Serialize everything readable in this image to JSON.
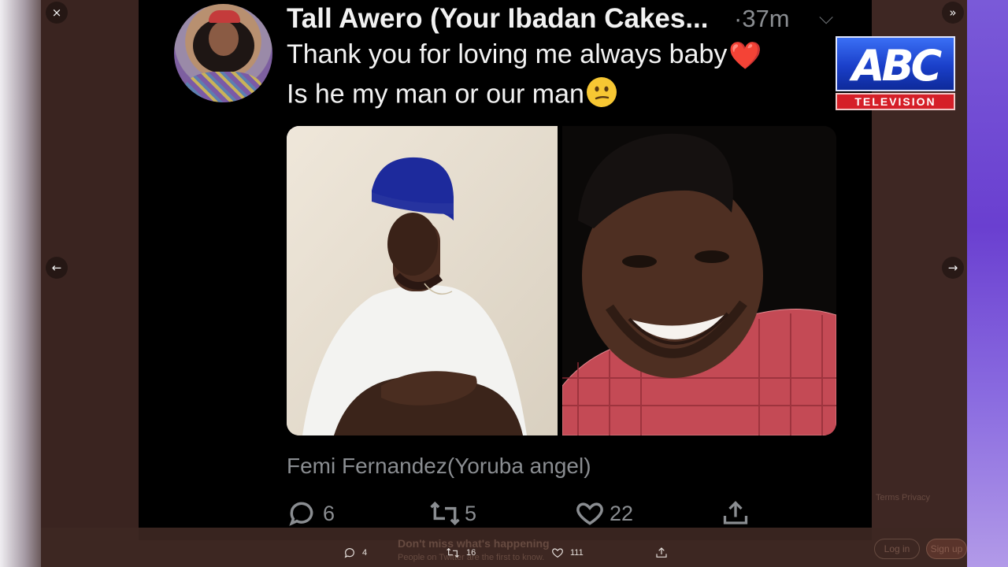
{
  "lightbox": {
    "close_icon": "×",
    "collapse_icon": "»",
    "prev_icon": "←",
    "next_icon": "→"
  },
  "tweet": {
    "author_name": "Tall Awero (Your Ibadan Cakes...",
    "time": "·37m",
    "caret_icon": "chevron-down-icon",
    "text_line1": "Thank you for loving me always baby",
    "text_line1_emoji": "❤️",
    "text_line2": "Is he my man or our man",
    "text_line2_emoji": "😕",
    "quoted_name": "Femi Fernandez(Yoruba angel)",
    "actions": {
      "replies": "6",
      "retweets": "5",
      "likes": "22"
    }
  },
  "background_bar": {
    "replies": "4",
    "retweets": "16",
    "likes": "111",
    "ghost_headline": "Don't miss what's happening",
    "ghost_sub": "People on Twitter are the first to know.",
    "login": "Log in",
    "signup": "Sign up",
    "ghost_side": "Terms Privacy"
  },
  "watermark": {
    "logo_text": "ABC",
    "sub_text": "TELEVISION"
  },
  "colors": {
    "card_bg": "#000000",
    "text_primary": "#f2f2f2",
    "text_secondary": "#8a8d91",
    "abc_blue": "#1a3fc9",
    "abc_red": "#d51f28"
  }
}
